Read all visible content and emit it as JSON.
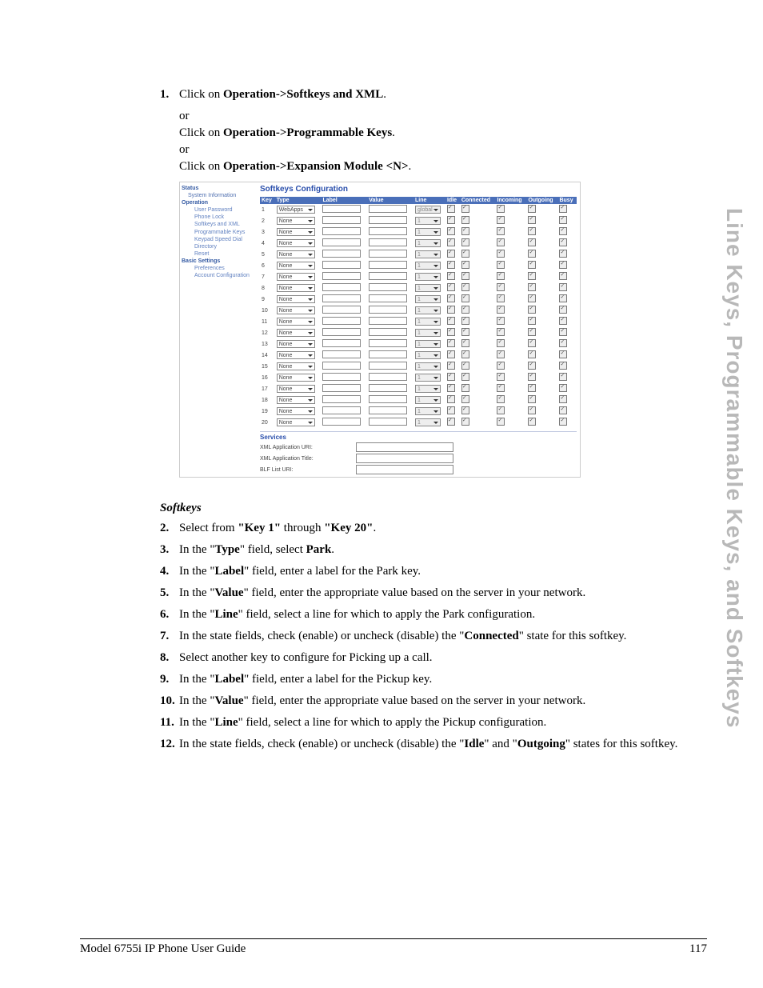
{
  "side_tab": "Line Keys, Programmable Keys, and Softkeys",
  "step1": {
    "num": "1.",
    "l1_pre": "Click on ",
    "l1_bold": "Operation->Softkeys and XML",
    "l1_post": ".",
    "or1": "or",
    "l2_pre": "Click on ",
    "l2_bold": "Operation->Programmable Keys",
    "l2_post": ".",
    "or2": "or",
    "l3_pre": "Click on ",
    "l3_bold": "Operation->Expansion Module <N>",
    "l3_post": "."
  },
  "nav": {
    "status": "Status",
    "sysinfo": "System Information",
    "operation": "Operation",
    "userpw": "User Password",
    "phonelock": "Phone Lock",
    "softkeys": "Softkeys and XML",
    "progkeys": "Programmable Keys",
    "keypad": "Keypad Speed Dial",
    "directory": "Directory",
    "reset": "Reset",
    "basic": "Basic Settings",
    "prefs": "Preferences",
    "acct": "Account Configuration"
  },
  "cfg": {
    "title": "Softkeys Configuration",
    "cols": {
      "key": "Key",
      "type": "Type",
      "label": "Label",
      "value": "Value",
      "line": "Line",
      "idle": "Idle",
      "connected": "Connected",
      "incoming": "Incoming",
      "outgoing": "Outgoing",
      "busy": "Busy"
    },
    "row1type": "WebApps",
    "row1line": "global",
    "none": "None",
    "lineval": "1",
    "services": "Services",
    "xml_uri": "XML Application URI:",
    "xml_title": "XML Application Title:",
    "blf": "BLF List URI:"
  },
  "section_hdr": "Softkeys",
  "steps": {
    "s2": {
      "num": "2.",
      "pre": "Select from ",
      "b1": "\"Key 1\"",
      "mid": " through ",
      "b2": "\"Key 20\"",
      "post": "."
    },
    "s3": {
      "num": "3.",
      "pre": "In the \"",
      "b1": "Type",
      "mid": "\" field, select ",
      "b2": "Park",
      "post": "."
    },
    "s4": {
      "num": "4.",
      "pre": "In the \"",
      "b1": "Label",
      "post": "\" field, enter a label for the Park key."
    },
    "s5": {
      "num": "5.",
      "pre": "In the \"",
      "b1": "Value",
      "post": "\" field, enter the appropriate value based on the server in your network."
    },
    "s6": {
      "num": "6.",
      "pre": "In the \"",
      "b1": "Line",
      "post": "\" field, select a line for which to apply the Park configuration."
    },
    "s7": {
      "num": "7.",
      "pre": "In the state fields, check (enable) or uncheck (disable) the \"",
      "b1": "Connected",
      "post": "\" state for this softkey."
    },
    "s8": {
      "num": "8.",
      "text": "Select another key to configure for Picking up a call."
    },
    "s9": {
      "num": "9.",
      "pre": "In the \"",
      "b1": "Label",
      "post": "\" field, enter a label for the Pickup key."
    },
    "s10": {
      "num": "10.",
      "pre": "In the \"",
      "b1": "Value",
      "post": "\" field, enter the appropriate value based on the server in your network."
    },
    "s11": {
      "num": "11.",
      "pre": "In the \"",
      "b1": "Line",
      "post": "\" field, select a line for which to apply the Pickup configuration."
    },
    "s12": {
      "num": "12.",
      "pre": "In the state fields, check (enable) or uncheck (disable) the \"",
      "b1": "Idle",
      "mid": "\" and \"",
      "b2": "Outgoing",
      "post": "\" states for this softkey."
    }
  },
  "footer": {
    "left": "Model 6755i IP Phone User Guide",
    "right": "117"
  }
}
